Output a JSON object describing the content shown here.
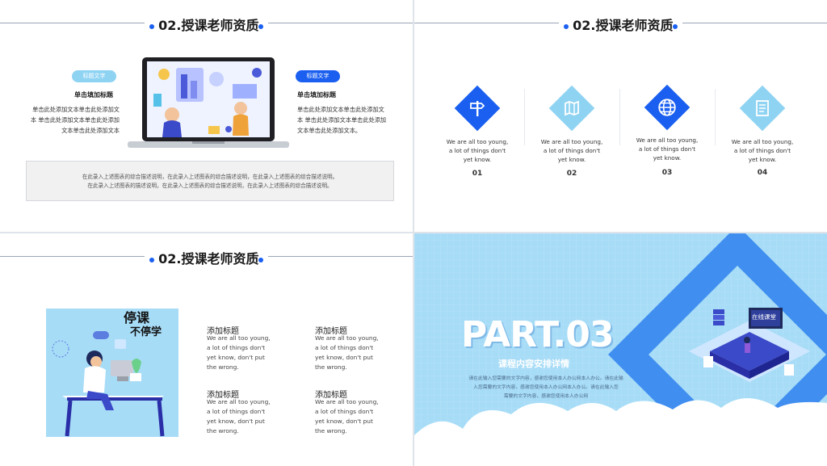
{
  "slide1": {
    "title": "02.授课老师资质",
    "left_pill": "标题文字",
    "left_heading": "单击填加标题",
    "left_body": [
      "单击此处添加文本单击此处添加文",
      "本 单击此处添加文本单击此处添加",
      "文本单击此处添加文本"
    ],
    "right_pill": "标题文字",
    "right_heading": "单击填加标题",
    "right_body": [
      "单击此处添加文本单击此处添加文",
      "本 单击此处添加文本单击此处添加",
      "文本单击此处添加文本。"
    ],
    "caption_lines": [
      "在此录入上述图表的综合描述说明，在此录入上述图表的综合描述说明，在此录入上述图表的综合描述说明。",
      "在此录入上述图表的描述说明，在此录入上述图表的综合描述说明，在此录入上述图表的综合描述说明。"
    ],
    "colors": {
      "left_pill": "#8fd3f3",
      "right_pill": "#1a5ff0"
    }
  },
  "slide2": {
    "title": "02.授课老师资质",
    "features": [
      {
        "icon": "signpost-icon",
        "text": "We are all too young, a lot of things don't yet know.",
        "num": "01",
        "color": "#1a5ff0"
      },
      {
        "icon": "map-icon",
        "text": "We are all too young, a lot of things don't yet know.",
        "num": "02",
        "color": "#8fd3f3"
      },
      {
        "icon": "globe-icon",
        "text": "We are all too young, a lot of things don't yet know.",
        "num": "03",
        "color": "#1a5ff0"
      },
      {
        "icon": "document-icon",
        "text": "We are all too young, a lot of things don't yet know.",
        "num": "04",
        "color": "#8fd3f3"
      }
    ]
  },
  "slide3": {
    "title": "02.授课老师资质",
    "illustration_lettering": [
      "停课",
      "不停学"
    ],
    "blocks": [
      {
        "title": "添加标题",
        "lines": [
          "We are all too young,",
          "a lot of things don't",
          "yet know, don't put",
          "the wrong."
        ]
      },
      {
        "title": "添加标题",
        "lines": [
          "We are all too young,",
          "a lot of things don't",
          "yet know, don't put",
          "the wrong."
        ]
      },
      {
        "title": "添加标题",
        "lines": [
          "We are all too young,",
          "a lot of things don't",
          "yet know, don't put",
          "the wrong."
        ]
      },
      {
        "title": "添加标题",
        "lines": [
          "We are all too young,",
          "a lot of things don't",
          "yet know, don't put",
          "the wrong."
        ]
      }
    ]
  },
  "slide4": {
    "part": "PART.03",
    "subtitle": "课程内容安排详情",
    "desc_lines": [
      "请在此输入您需要的文字内容，感谢您使用本人办公网本人办公。请在此输",
      "入您需要的文字内容，感谢您使用本人办公网本人办公。请在此输入您",
      "需要的文字内容，感谢您使用本人办公网"
    ],
    "screen_label": "在线课堂",
    "colors": {
      "bg": "#a7dcf7",
      "diamond": "#3f8ef0",
      "cloud": "#ffffff"
    }
  }
}
